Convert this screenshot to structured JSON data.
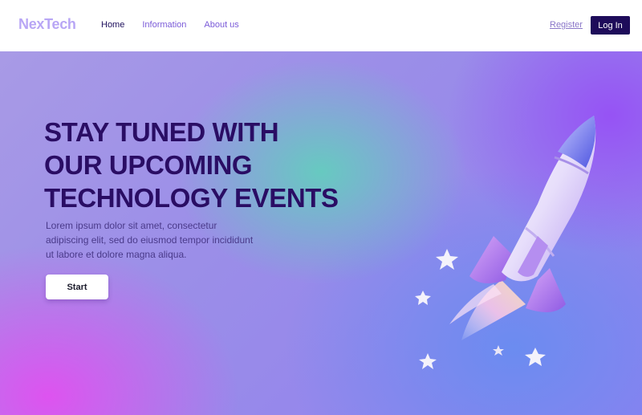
{
  "header": {
    "logo": "NexTech",
    "nav": [
      {
        "label": "Home",
        "active": true
      },
      {
        "label": "Information",
        "active": false
      },
      {
        "label": "About us",
        "active": false
      }
    ],
    "register_label": "Register",
    "login_label": "Log In"
  },
  "hero": {
    "title_lines": [
      "STAY TUNED WITH",
      "OUR UPCOMING",
      "TECHNOLOGY EVENTS"
    ],
    "description": "Lorem ipsum dolor sit amet, consectetur adipiscing elit, sed do eiusmod tempor incididunt ut labore et dolore magna aliqua.",
    "start_label": "Start",
    "illustration": "rocket-icon"
  },
  "colors": {
    "brand_dark": "#1e0c5a",
    "logo": "#b8a6f5",
    "nav": "#7a5ad8"
  }
}
